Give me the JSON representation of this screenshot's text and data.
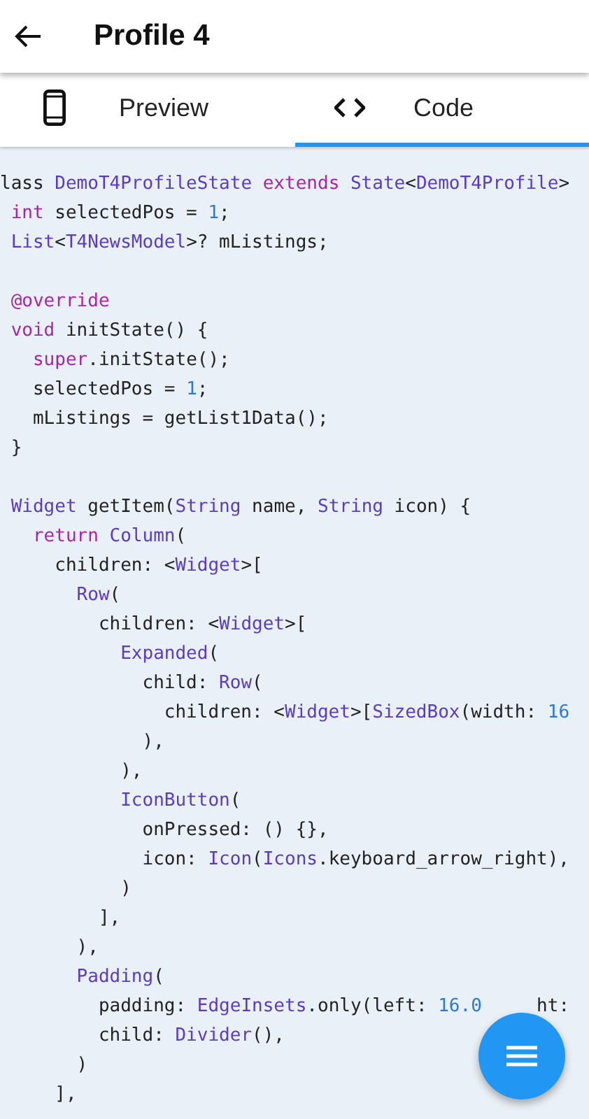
{
  "app_bar": {
    "title": "Profile 4"
  },
  "tabs": [
    {
      "label": "Preview",
      "selected": false
    },
    {
      "label": "Code",
      "selected": true
    }
  ],
  "code_lines": [
    {
      "kind": "code",
      "tokens": [
        {
          "kind": "plain",
          "text": "lass "
        },
        {
          "kind": "type",
          "text": "DemoT4ProfileState "
        },
        {
          "kind": "keyword",
          "text": "extends "
        },
        {
          "kind": "type",
          "text": "State"
        },
        {
          "kind": "plain",
          "text": "<"
        },
        {
          "kind": "type",
          "text": "DemoT4Profile"
        },
        {
          "kind": "plain",
          "text": ">"
        }
      ]
    },
    {
      "kind": "code",
      "tokens": [
        {
          "kind": "keyword",
          "text": " int"
        },
        {
          "kind": "plain",
          "text": " selectedPos = "
        },
        {
          "kind": "number",
          "text": "1"
        },
        {
          "kind": "plain",
          "text": ";"
        }
      ]
    },
    {
      "kind": "code",
      "tokens": [
        {
          "kind": "type",
          "text": " List"
        },
        {
          "kind": "plain",
          "text": "<"
        },
        {
          "kind": "type",
          "text": "T4NewsModel"
        },
        {
          "kind": "plain",
          "text": ">? mListings;"
        }
      ]
    },
    {
      "kind": "blank"
    },
    {
      "kind": "code",
      "tokens": [
        {
          "kind": "keyword",
          "text": " @override"
        }
      ]
    },
    {
      "kind": "code",
      "tokens": [
        {
          "kind": "keyword",
          "text": " void"
        },
        {
          "kind": "plain",
          "text": " initState() {"
        }
      ]
    },
    {
      "kind": "code",
      "tokens": [
        {
          "kind": "keyword",
          "text": "   super"
        },
        {
          "kind": "plain",
          "text": ".initState();"
        }
      ]
    },
    {
      "kind": "code",
      "tokens": [
        {
          "kind": "plain",
          "text": "   selectedPos = "
        },
        {
          "kind": "number",
          "text": "1"
        },
        {
          "kind": "plain",
          "text": ";"
        }
      ]
    },
    {
      "kind": "code",
      "tokens": [
        {
          "kind": "plain",
          "text": "   mListings = getList1Data();"
        }
      ]
    },
    {
      "kind": "code",
      "tokens": [
        {
          "kind": "plain",
          "text": " }"
        }
      ]
    },
    {
      "kind": "blank"
    },
    {
      "kind": "code",
      "tokens": [
        {
          "kind": "type",
          "text": " Widget"
        },
        {
          "kind": "plain",
          "text": " getItem("
        },
        {
          "kind": "type",
          "text": "String"
        },
        {
          "kind": "plain",
          "text": " name, "
        },
        {
          "kind": "type",
          "text": "String"
        },
        {
          "kind": "plain",
          "text": " icon) {"
        }
      ]
    },
    {
      "kind": "code",
      "tokens": [
        {
          "kind": "keyword",
          "text": "   return "
        },
        {
          "kind": "type",
          "text": "Column"
        },
        {
          "kind": "plain",
          "text": "("
        }
      ]
    },
    {
      "kind": "code",
      "tokens": [
        {
          "kind": "plain",
          "text": "     children: <"
        },
        {
          "kind": "type",
          "text": "Widget"
        },
        {
          "kind": "plain",
          "text": ">["
        }
      ]
    },
    {
      "kind": "code",
      "tokens": [
        {
          "kind": "type",
          "text": "       Row"
        },
        {
          "kind": "plain",
          "text": "("
        }
      ]
    },
    {
      "kind": "code",
      "tokens": [
        {
          "kind": "plain",
          "text": "         children: <"
        },
        {
          "kind": "type",
          "text": "Widget"
        },
        {
          "kind": "plain",
          "text": ">["
        }
      ]
    },
    {
      "kind": "code",
      "tokens": [
        {
          "kind": "type",
          "text": "           Expanded"
        },
        {
          "kind": "plain",
          "text": "("
        }
      ]
    },
    {
      "kind": "code",
      "tokens": [
        {
          "kind": "plain",
          "text": "             child: "
        },
        {
          "kind": "type",
          "text": "Row"
        },
        {
          "kind": "plain",
          "text": "("
        }
      ]
    },
    {
      "kind": "code",
      "tokens": [
        {
          "kind": "plain",
          "text": "               children: <"
        },
        {
          "kind": "type",
          "text": "Widget"
        },
        {
          "kind": "plain",
          "text": ">["
        },
        {
          "kind": "type",
          "text": "SizedBox"
        },
        {
          "kind": "plain",
          "text": "(width: "
        },
        {
          "kind": "number",
          "text": "16"
        }
      ]
    },
    {
      "kind": "code",
      "tokens": [
        {
          "kind": "plain",
          "text": "             ),"
        }
      ]
    },
    {
      "kind": "code",
      "tokens": [
        {
          "kind": "plain",
          "text": "           ),"
        }
      ]
    },
    {
      "kind": "code",
      "tokens": [
        {
          "kind": "type",
          "text": "           IconButton"
        },
        {
          "kind": "plain",
          "text": "("
        }
      ]
    },
    {
      "kind": "code",
      "tokens": [
        {
          "kind": "plain",
          "text": "             onPressed: () {},"
        }
      ]
    },
    {
      "kind": "code",
      "tokens": [
        {
          "kind": "plain",
          "text": "             icon: "
        },
        {
          "kind": "type",
          "text": "Icon"
        },
        {
          "kind": "plain",
          "text": "("
        },
        {
          "kind": "type",
          "text": "Icons"
        },
        {
          "kind": "plain",
          "text": ".keyboard_arrow_right),"
        }
      ]
    },
    {
      "kind": "code",
      "tokens": [
        {
          "kind": "plain",
          "text": "           )"
        }
      ]
    },
    {
      "kind": "code",
      "tokens": [
        {
          "kind": "plain",
          "text": "         ],"
        }
      ]
    },
    {
      "kind": "code",
      "tokens": [
        {
          "kind": "plain",
          "text": "       ),"
        }
      ]
    },
    {
      "kind": "code",
      "tokens": [
        {
          "kind": "type",
          "text": "       Padding"
        },
        {
          "kind": "plain",
          "text": "("
        }
      ]
    },
    {
      "kind": "code",
      "tokens": [
        {
          "kind": "plain",
          "text": "         padding: "
        },
        {
          "kind": "type",
          "text": "EdgeInsets"
        },
        {
          "kind": "plain",
          "text": ".only(left: "
        },
        {
          "kind": "number",
          "text": "16.0"
        },
        {
          "kind": "plain",
          "text": "     ht:"
        }
      ]
    },
    {
      "kind": "code",
      "tokens": [
        {
          "kind": "plain",
          "text": "         child: "
        },
        {
          "kind": "type",
          "text": "Divider"
        },
        {
          "kind": "plain",
          "text": "(),"
        }
      ]
    },
    {
      "kind": "code",
      "tokens": [
        {
          "kind": "plain",
          "text": "       )"
        }
      ]
    },
    {
      "kind": "code",
      "tokens": [
        {
          "kind": "plain",
          "text": "     ],"
        }
      ]
    }
  ]
}
